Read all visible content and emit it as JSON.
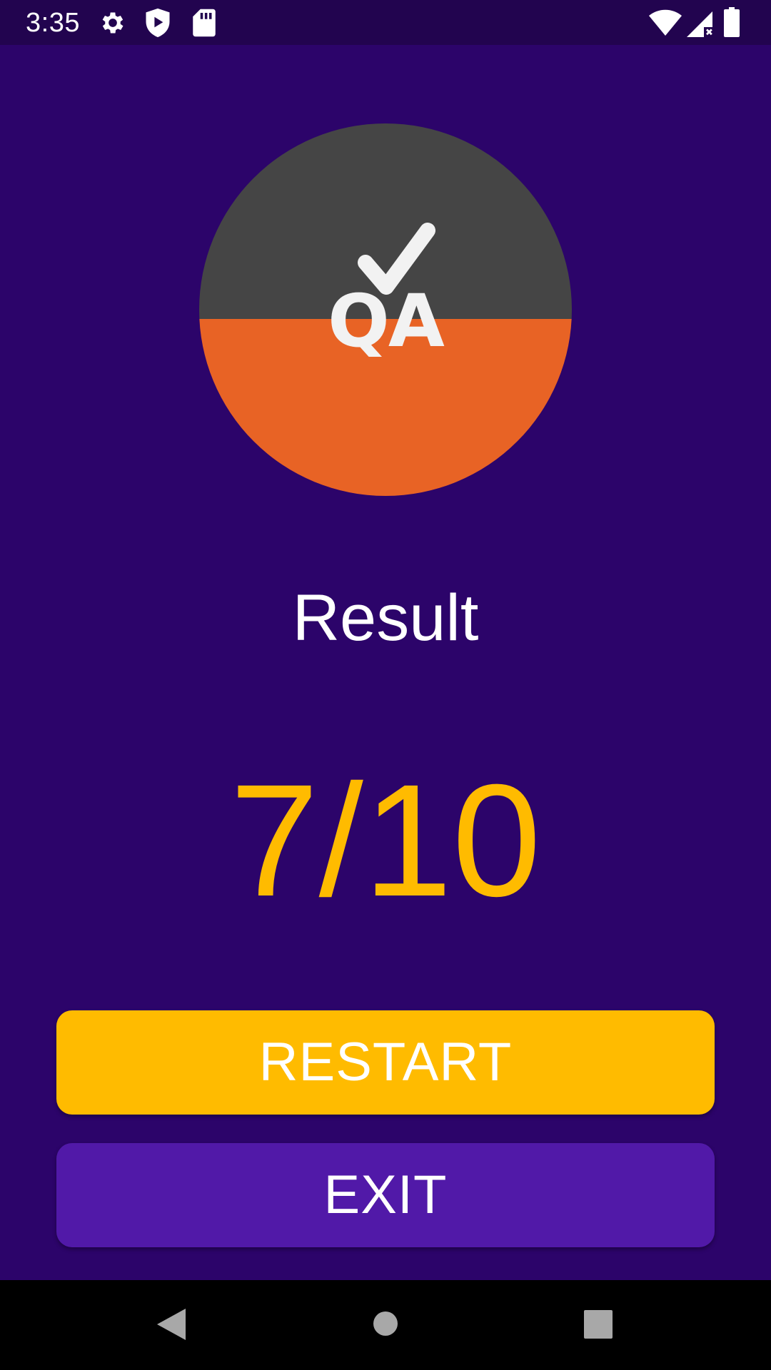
{
  "status_bar": {
    "time": "3:35",
    "left_icons": [
      "gear-icon",
      "shield-play-icon",
      "sd-card-icon"
    ],
    "right_icons": [
      "wifi-icon",
      "cell-signal-icon",
      "battery-icon"
    ]
  },
  "logo": {
    "text": "QA",
    "icon": "checkmark-icon",
    "colors": {
      "top": "#454545",
      "bottom": "#e86325",
      "glyph": "#f2f2f2"
    }
  },
  "result": {
    "title": "Result",
    "score": "7/10"
  },
  "buttons": {
    "restart_label": "RESTART",
    "exit_label": "EXIT"
  },
  "nav_bar": {
    "icons": [
      "back-triangle-icon",
      "home-circle-icon",
      "recents-square-icon"
    ]
  },
  "colors": {
    "background": "#2c046a",
    "status_bar": "#22044f",
    "accent": "#ffbb00",
    "exit_button": "#5119a8"
  }
}
